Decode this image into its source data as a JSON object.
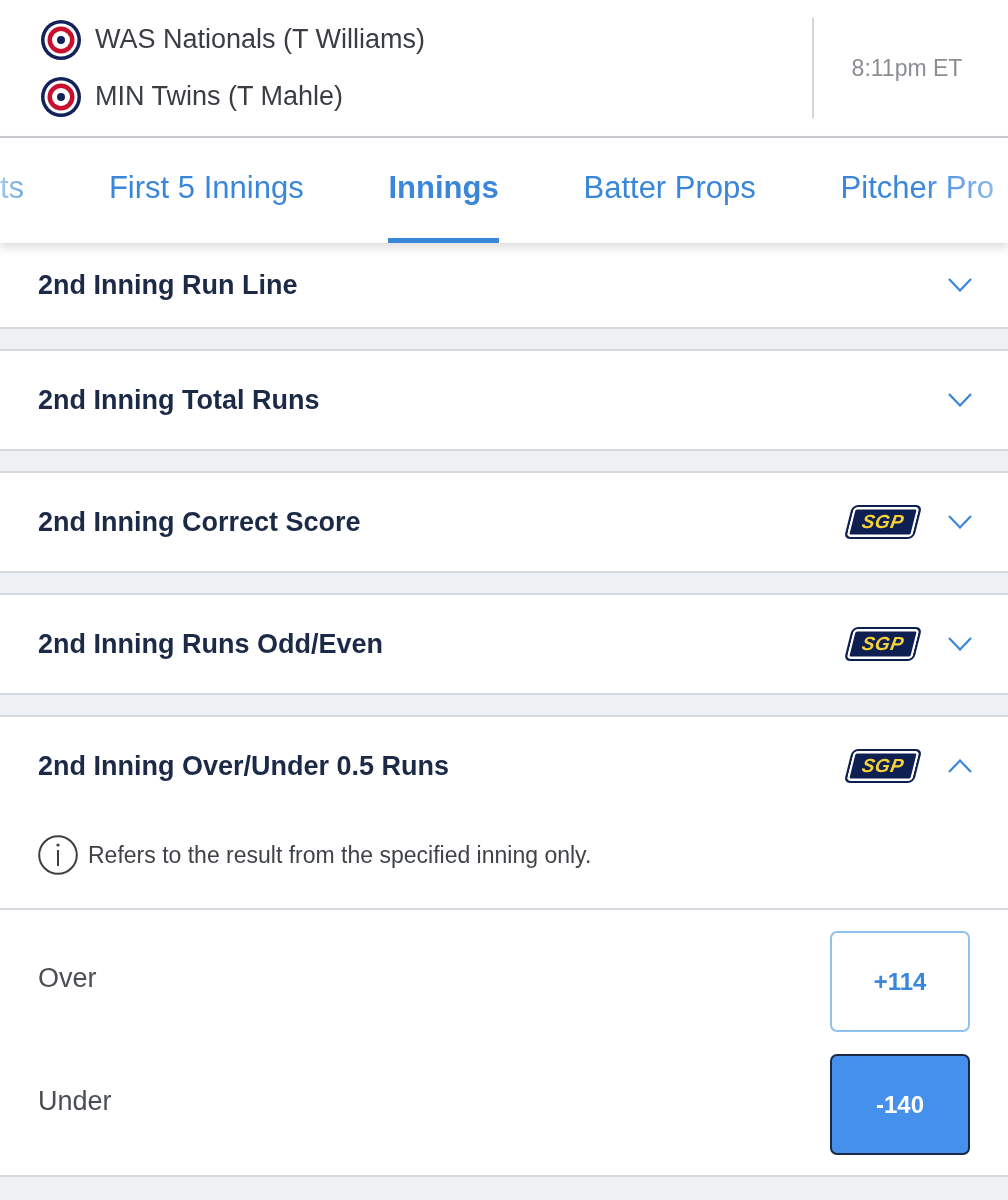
{
  "header": {
    "teams": [
      {
        "name": "WAS Nationals (T Williams)"
      },
      {
        "name": "MIN Twins (T Mahle)"
      }
    ],
    "time": "8:11pm ET"
  },
  "tabs": [
    {
      "label": "ts",
      "selected": false
    },
    {
      "label": "First 5 Innings",
      "selected": false
    },
    {
      "label": "Innings",
      "selected": true
    },
    {
      "label": "Batter Props",
      "selected": false
    },
    {
      "label": "Pitcher Pro",
      "selected": false
    }
  ],
  "sections": [
    {
      "title": "2nd Inning Run Line",
      "expanded": false
    },
    {
      "title": "2nd Inning Total Runs",
      "expanded": false
    },
    {
      "title": "2nd Inning Correct Score",
      "badge": "SGP",
      "expanded": false
    },
    {
      "title": "2nd Inning Runs Odd/Even",
      "badge": "SGP",
      "expanded": false
    },
    {
      "title": "2nd Inning Over/Under 0.5 Runs",
      "badge": "SGP",
      "expanded": true,
      "info": "Refers to the result from the specified inning only.",
      "outcomes": [
        {
          "label": "Over",
          "odds": "+114",
          "selected": false
        },
        {
          "label": "Under",
          "odds": "-140",
          "selected": true
        }
      ]
    }
  ]
}
